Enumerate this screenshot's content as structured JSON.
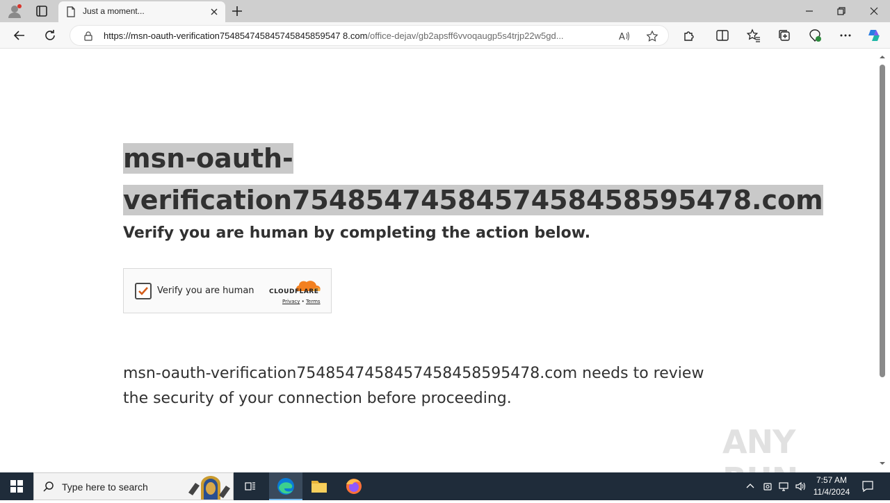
{
  "browser": {
    "tab_title": "Just a moment...",
    "url_host": "https://msn-oauth-verification75485474584574584585954​78.com",
    "url_host_clean": "https://msn-oauth-verification754854745845745845859547 8.com",
    "url_display_host": "https://msn-oauth-verification754854745845745845859547​8.com",
    "url_path": "/office-dejav/gb2apsff6vvoqaugp5s4trjp22w5gd..."
  },
  "page": {
    "heading_line1": "msn-oauth-",
    "heading_line2": "verification7548547458457458458595478.com",
    "subheading": "Verify you are human by completing the action below.",
    "widget": {
      "checkbox_label": "Verify you are human",
      "brand": "CLOUDFLARE",
      "privacy": "Privacy",
      "separator": "•",
      "terms": "Terms"
    },
    "paragraph": "msn-oauth-verification7548547458457458458595478.com needs to review the security of your connection before proceeding.",
    "watermark": "ANY RUN"
  },
  "taskbar": {
    "search_placeholder": "Type here to search",
    "time": "7:57 AM",
    "date": "11/4/2024"
  },
  "colors": {
    "edge_blue": "#0a7bd6",
    "cloudflare_orange": "#f38020",
    "checkmark": "#d35c1a"
  }
}
